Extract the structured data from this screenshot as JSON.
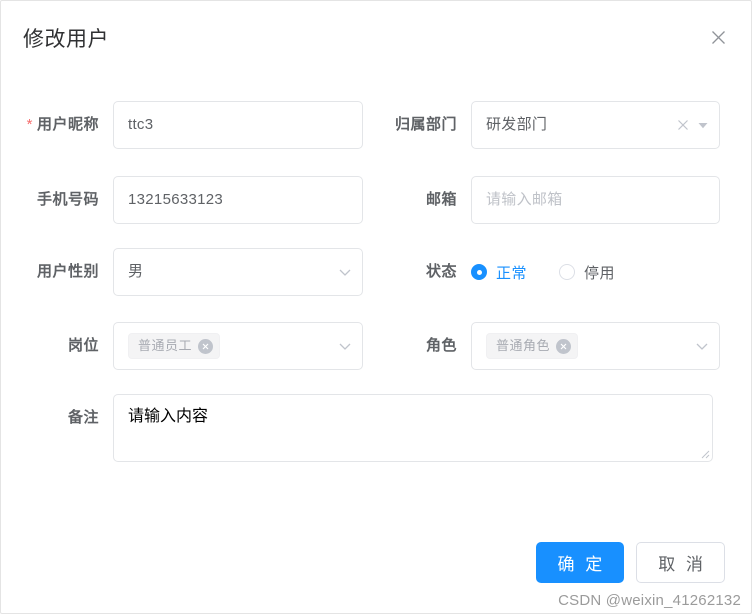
{
  "dialog": {
    "title": "修改用户",
    "close_icon": "close-icon"
  },
  "colors": {
    "primary": "#1890ff",
    "required_star": "#f56c6c",
    "label_text": "#5f6266",
    "placeholder": "#bfc2c8",
    "border": "#e3e5e8",
    "tag_bg": "#f4f4f5"
  },
  "form": {
    "nickname": {
      "label": "用户昵称",
      "required_mark": "*",
      "value": "ttc3"
    },
    "department": {
      "label": "归属部门",
      "value": "研发部门",
      "clear_icon": "close-small-icon",
      "dropdown_icon": "caret-down-icon"
    },
    "phone": {
      "label": "手机号码",
      "value": "13215633123"
    },
    "email": {
      "label": "邮箱",
      "value": "",
      "placeholder": "请输入邮箱"
    },
    "gender": {
      "label": "用户性别",
      "value": "男",
      "dropdown_icon": "chevron-down-icon"
    },
    "status": {
      "label": "状态",
      "options": [
        {
          "label": "正常",
          "checked": true
        },
        {
          "label": "停用",
          "checked": false
        }
      ]
    },
    "post": {
      "label": "岗位",
      "tags": [
        {
          "text": "普通员工"
        }
      ],
      "dropdown_icon": "chevron-down-icon"
    },
    "role": {
      "label": "角色",
      "tags": [
        {
          "text": "普通角色"
        }
      ],
      "dropdown_icon": "chevron-down-icon"
    },
    "remark": {
      "label": "备注",
      "value": "",
      "placeholder": "请输入内容"
    }
  },
  "footer": {
    "confirm_label": "确 定",
    "cancel_label": "取 消"
  },
  "watermark": {
    "text": "CSDN @weixin_41262132"
  }
}
